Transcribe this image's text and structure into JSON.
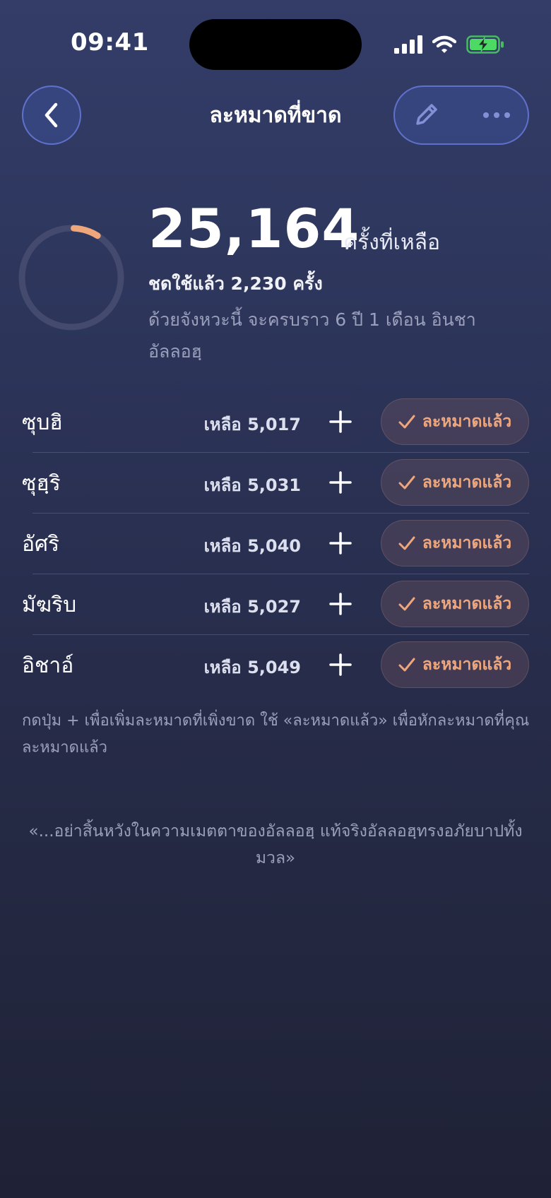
{
  "status_bar": {
    "time": "09:41",
    "icons": [
      "signal-icon",
      "wifi-icon",
      "battery-charging-icon"
    ],
    "battery_color": "#4cd964"
  },
  "header": {
    "title": "ละหมาดที่ขาด",
    "back_icon": "chevron-left-icon",
    "edit_icon": "pencil-icon",
    "more_icon": "more-dots-icon"
  },
  "summary": {
    "remaining_value": "25,164",
    "remaining_label": "ครั้งที่เหลือ",
    "used_text": "ชดใช้แล้ว 2,230 ครั้ง",
    "estimate_text": "ด้วยจังหวะนี้ จะครบราว 6 ปี 1 เดือน อินชาอัลลอฮฺ",
    "progress_fraction": 0.081,
    "accent_color": "#eea67a"
  },
  "prayers": [
    {
      "name": "ซุบฮิ",
      "remaining": "เหลือ 5,017",
      "done_label": "ละหมาดแล้ว"
    },
    {
      "name": "ซุฮฺริ",
      "remaining": "เหลือ 5,031",
      "done_label": "ละหมาดแล้ว"
    },
    {
      "name": "อัศริ",
      "remaining": "เหลือ 5,040",
      "done_label": "ละหมาดแล้ว"
    },
    {
      "name": "มัฆริบ",
      "remaining": "เหลือ 5,027",
      "done_label": "ละหมาดแล้ว"
    },
    {
      "name": "อิชาอ์",
      "remaining": "เหลือ 5,049",
      "done_label": "ละหมาดแล้ว"
    }
  ],
  "hint": "กดปุ่ม + เพื่อเพิ่มละหมาดที่เพิ่งขาด ใช้ «ละหมาดแล้ว» เพื่อหักละหมาดที่คุณละหมาดแล้ว",
  "quote": "«...อย่าสิ้นหวังในความเมตตาของอัลลอฮฺ แท้จริงอัลลอฮฺทรงอภัยบาปทั้งมวล»"
}
